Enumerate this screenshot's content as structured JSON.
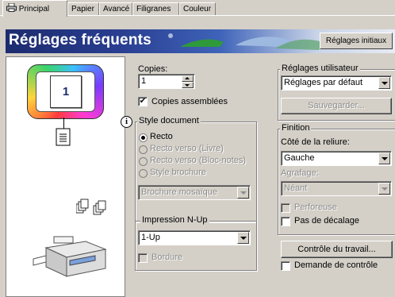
{
  "tabs": [
    {
      "label": "Principal",
      "active": true
    },
    {
      "label": "Papier"
    },
    {
      "label": "Avancé"
    },
    {
      "label": "Filigranes"
    },
    {
      "label": "Couleur"
    }
  ],
  "banner": {
    "title": "Réglages fréquents",
    "button": "Réglages initiaux"
  },
  "preview": {
    "page_number": "1"
  },
  "copies": {
    "label": "Copies:",
    "value": "1",
    "collate_label": "Copies assemblées",
    "collate_checked": true
  },
  "style": {
    "title": "Style document",
    "options": [
      "Recto",
      "Recto verso (Livre)",
      "Recto verso (Bloc-notes)",
      "Style brochure"
    ],
    "selected": "Recto",
    "brochure_select": "Brochure mosaïque"
  },
  "nup": {
    "title": "Impression N-Up",
    "value": "1-Up",
    "border_label": "Bordure"
  },
  "user_settings": {
    "title": "Réglages utilisateur",
    "value": "Réglages par défaut",
    "save_button": "Sauvegarder..."
  },
  "finishing": {
    "title": "Finition",
    "binding_label": "Côté de la reliure:",
    "binding_value": "Gauche",
    "stapling_label": "Agrafage:",
    "stapling_value": "Néant",
    "punch_label": "Perforeuse",
    "no_offset_label": "Pas de décalage"
  },
  "job_control": {
    "button": "Contrôle du travail...",
    "request_label": "Demande de contrôle"
  },
  "colors": {
    "banner_dark": "#1d2b6e",
    "banner_light": "#e7ebf3",
    "face": "#d4d0c8"
  }
}
